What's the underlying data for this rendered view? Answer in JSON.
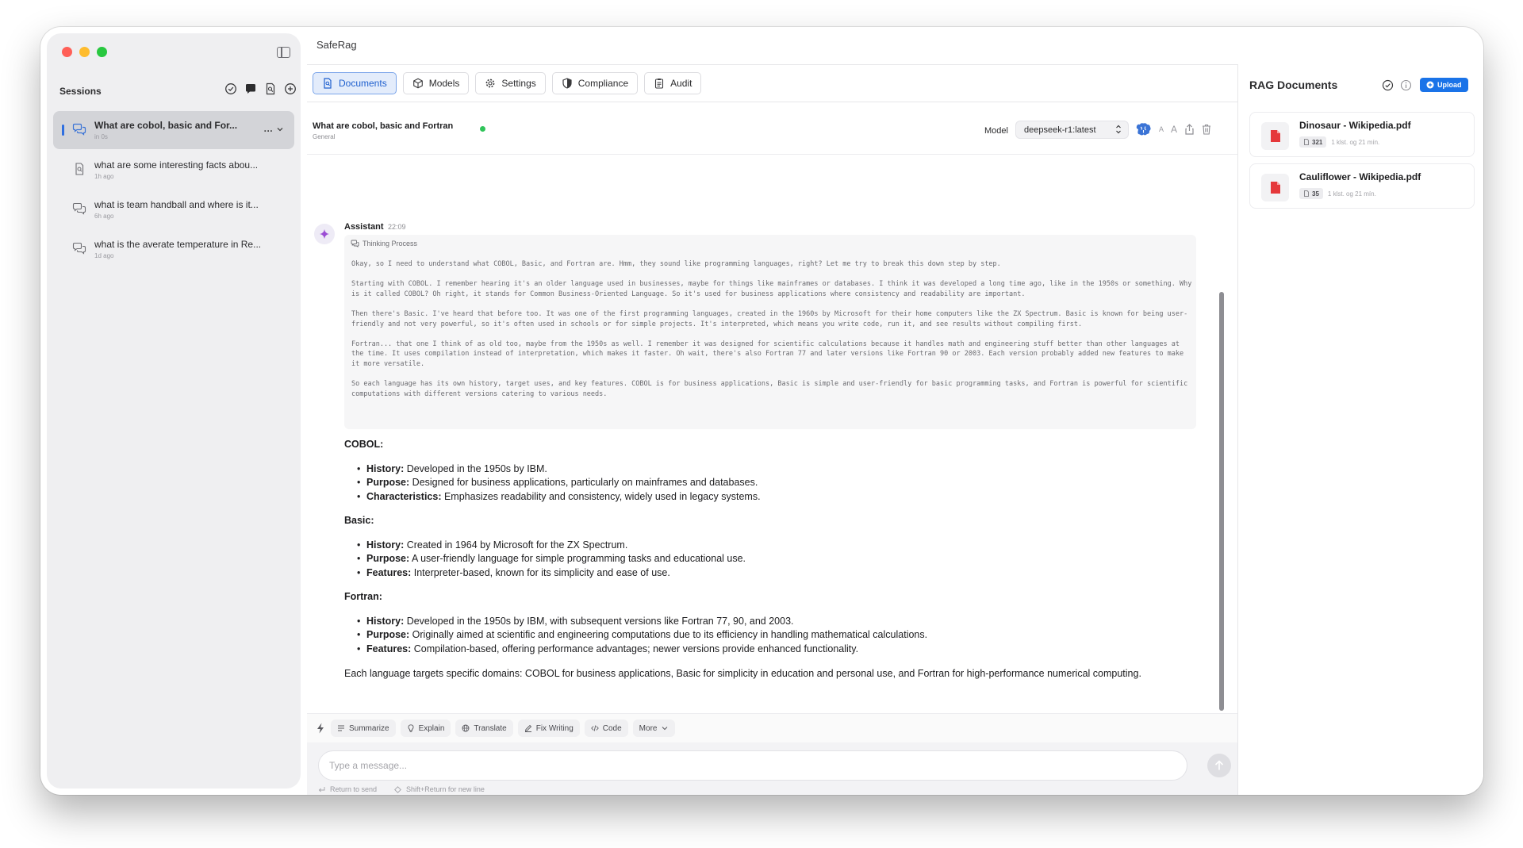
{
  "app": {
    "title": "SafeRag"
  },
  "sidebar": {
    "sessions_title": "Sessions",
    "sessions": [
      {
        "title": "What are cobol, basic and For...",
        "time": "in 0s",
        "icon": "chat-bubbles-icon",
        "active": true,
        "more": "..."
      },
      {
        "title": "what are some interesting facts abou...",
        "time": "1h ago",
        "icon": "document-icon",
        "active": false
      },
      {
        "title": "what is team handball and where is it...",
        "time": "6h ago",
        "icon": "chat-bubbles-icon",
        "active": false
      },
      {
        "title": "what is the averate temperature in Re...",
        "time": "1d ago",
        "icon": "chat-bubbles-icon",
        "active": false
      }
    ]
  },
  "tabs": [
    {
      "label": "Documents",
      "icon": "document-search-icon",
      "active": true
    },
    {
      "label": "Models",
      "icon": "cube-icon",
      "active": false
    },
    {
      "label": "Settings",
      "icon": "gear-icon",
      "active": false
    },
    {
      "label": "Compliance",
      "icon": "shield-icon",
      "active": false
    },
    {
      "label": "Audit",
      "icon": "clipboard-icon",
      "active": false
    }
  ],
  "chat": {
    "title": "What are cobol, basic and Fortran",
    "category": "General",
    "status_color": "#30c45a",
    "model_label": "Model",
    "model_value": "deepseek-r1:latest",
    "font_small": "A",
    "font_large": "A"
  },
  "message": {
    "author": "Assistant",
    "time": "22:09",
    "thinking_label": "Thinking Process",
    "thinking_paragraphs": [
      "Okay, so I need to understand what COBOL, Basic, and Fortran are. Hmm, they sound like programming languages, right? Let me try to break this down step by step.",
      "Starting with COBOL. I remember hearing it's an older language used in businesses, maybe for things like mainframes or databases. I think it was developed a long time ago, like in the 1950s or something. Why is it called COBOL? Oh right, it stands for Common Business-Oriented Language. So it's used for business applications where consistency and readability are important.",
      "Then there's Basic. I've heard that before too. It was one of the first programming languages, created in the 1960s by Microsoft for their home computers like the ZX Spectrum. Basic is known for being user-friendly and not very powerful, so it's often used in schools or for simple projects. It's interpreted, which means you write code, run it, and see results without compiling first.",
      "Fortran... that one I think of as old too, maybe from the 1950s as well. I remember it was designed for scientific calculations because it handles math and engineering stuff better than other languages at the time. It uses compilation instead of interpretation, which makes it faster. Oh wait, there's also Fortran 77 and later versions like Fortran 90 or 2003. Each version probably added new features to make it more versatile.",
      "So each language has its own history, target uses, and key features. COBOL is for business applications, Basic is simple and user-friendly for basic programming tasks, and Fortran is powerful for scientific computations with different versions catering to various needs."
    ],
    "sections": [
      {
        "heading": "COBOL:",
        "items": [
          {
            "label": "History:",
            "text": " Developed in the 1950s by IBM."
          },
          {
            "label": "Purpose:",
            "text": " Designed for business applications, particularly on mainframes and databases."
          },
          {
            "label": "Characteristics:",
            "text": " Emphasizes readability and consistency, widely used in legacy systems."
          }
        ]
      },
      {
        "heading": "Basic:",
        "items": [
          {
            "label": "History:",
            "text": " Created in 1964 by Microsoft for the ZX Spectrum."
          },
          {
            "label": "Purpose:",
            "text": " A user-friendly language for simple programming tasks and educational use."
          },
          {
            "label": "Features:",
            "text": " Interpreter-based, known for its simplicity and ease of use."
          }
        ]
      },
      {
        "heading": "Fortran:",
        "items": [
          {
            "label": "History:",
            "text": " Developed in the 1950s by IBM, with subsequent versions like Fortran 77, 90, and 2003."
          },
          {
            "label": "Purpose:",
            "text": " Originally aimed at scientific and engineering computations due to its efficiency in handling mathematical calculations."
          },
          {
            "label": "Features:",
            "text": " Compilation-based, offering performance advantages; newer versions provide enhanced functionality."
          }
        ]
      }
    ],
    "closing": "Each language targets specific domains: COBOL for business applications, Basic for simplicity in education and personal use, and Fortran for high-performance numerical computing."
  },
  "quick_actions": {
    "items": [
      {
        "label": "Summarize",
        "icon": "lines-icon"
      },
      {
        "label": "Explain",
        "icon": "lightbulb-icon"
      },
      {
        "label": "Translate",
        "icon": "globe-icon"
      },
      {
        "label": "Fix Writing",
        "icon": "pencil-icon"
      },
      {
        "label": "Code",
        "icon": "code-icon"
      },
      {
        "label": "More",
        "icon": "chevron-down-icon"
      }
    ]
  },
  "composer": {
    "placeholder": "Type a message...",
    "hint_send": "Return to send",
    "hint_newline": "Shift+Return for new line"
  },
  "rag": {
    "title": "RAG Documents",
    "upload_label": "Upload",
    "accent_color": "#1a73e8",
    "documents": [
      {
        "name": "Dinosaur - Wikipedia.pdf",
        "chunks": "321",
        "time": "1 klst. og 21 mín."
      },
      {
        "name": "Cauliflower - Wikipedia.pdf",
        "chunks": "35",
        "time": "1 klst. og 21 mín."
      }
    ]
  }
}
